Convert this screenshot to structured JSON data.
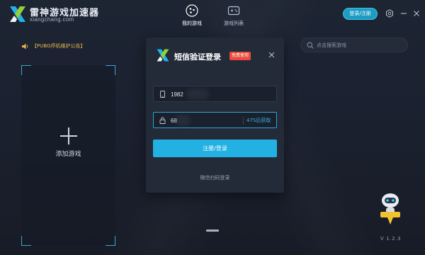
{
  "app": {
    "brand_name": "雷神游戏加速器",
    "brand_url": "xiangchang.com"
  },
  "nav": [
    {
      "label": "我的游戏",
      "icon": "controller-circle-icon",
      "active": true
    },
    {
      "label": "游戏列表",
      "icon": "gamepad-icon",
      "active": false
    }
  ],
  "header": {
    "login_label": "登录/注册"
  },
  "announcement": {
    "text": "【PUBG停机维护公告】"
  },
  "game_area": {
    "add_label": "添加游戏"
  },
  "search": {
    "placeholder": "点击搜索游戏",
    "value": ""
  },
  "login_modal": {
    "title": "短信验证登录",
    "badge": "免费使用",
    "phone_value": "1982",
    "code_value": "68",
    "resend_label": "47S后获取",
    "submit_label": "注册/登录",
    "wechat_label": "微信扫码登录"
  },
  "footer": {
    "version": "V 1.2.3"
  },
  "colors": {
    "accent": "#22b1e2",
    "badge": "#ee4a3b",
    "announcement": "#e7b84a",
    "background": "#1b2130"
  }
}
